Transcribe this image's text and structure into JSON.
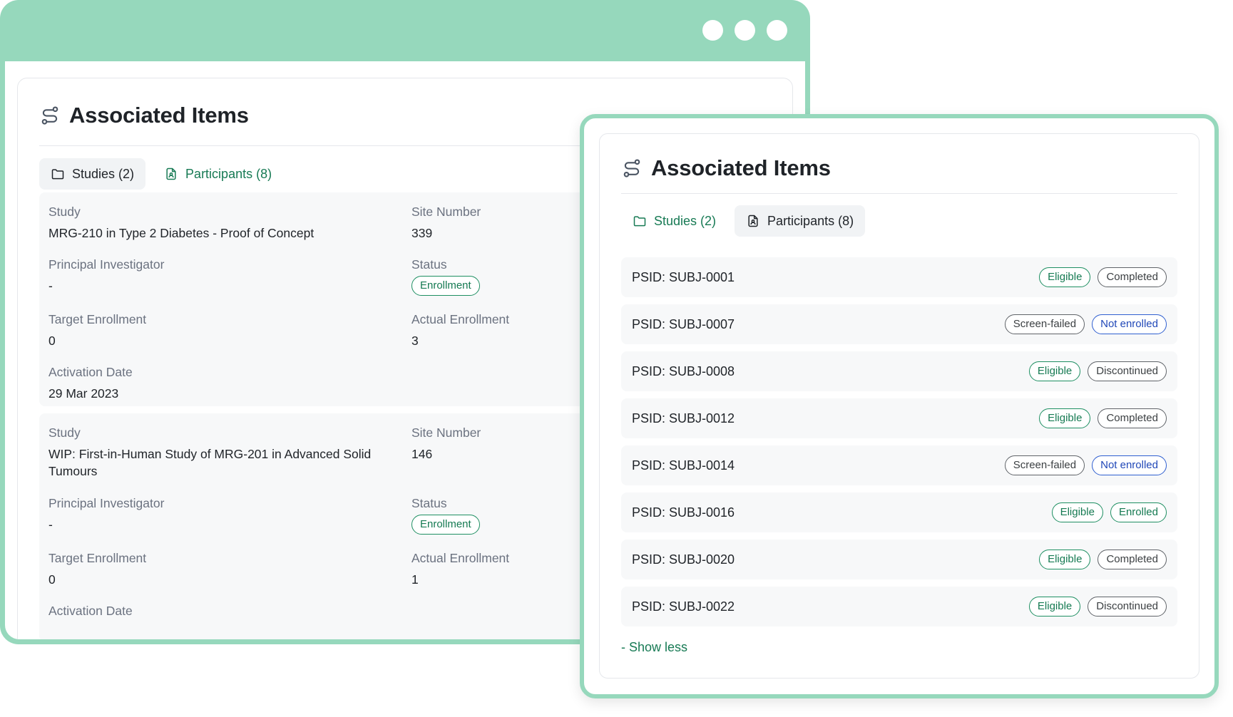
{
  "colors": {
    "frame": "#96d8bc",
    "accent": "#177a54",
    "badge_green": "#1e8f62",
    "badge_blue": "#2f5fd0",
    "badge_gray": "#5f6368"
  },
  "back_panel": {
    "title": "Associated Items",
    "header_icon": "route-icon",
    "tabs": [
      {
        "label": "Studies (2)",
        "icon": "folder-icon",
        "active": true
      },
      {
        "label": "Participants (8)",
        "icon": "file-user-icon",
        "active": false
      }
    ],
    "studies": [
      {
        "study_label": "Study",
        "study_value": "MRG-210 in Type 2 Diabetes - Proof of Concept",
        "site_label": "Site Number",
        "site_value": "339",
        "pi_label": "Principal Investigator",
        "pi_value": "-",
        "status_label": "Status",
        "status_value": "Enrollment",
        "target_label": "Target Enrollment",
        "target_value": "0",
        "actual_label": "Actual Enrollment",
        "actual_value": "3",
        "activation_label": "Activation Date",
        "activation_value": "29 Mar 2023"
      },
      {
        "study_label": "Study",
        "study_value": "WIP: First-in-Human Study of MRG-201 in Advanced Solid Tumours",
        "site_label": "Site Number",
        "site_value": "146",
        "pi_label": "Principal Investigator",
        "pi_value": "-",
        "status_label": "Status",
        "status_value": "Enrollment",
        "target_label": "Target Enrollment",
        "target_value": "0",
        "actual_label": "Actual Enrollment",
        "actual_value": "1",
        "activation_label": "Activation Date"
      }
    ]
  },
  "front_panel": {
    "title": "Associated Items",
    "header_icon": "route-icon",
    "tabs": [
      {
        "label": "Studies (2)",
        "icon": "folder-icon",
        "active": false
      },
      {
        "label": "Participants (8)",
        "icon": "file-user-icon",
        "active": true
      }
    ],
    "participants": [
      {
        "psid": "PSID: SUBJ-0001",
        "eligibility": "Eligible",
        "status": "Completed"
      },
      {
        "psid": "PSID: SUBJ-0007",
        "eligibility": "Screen-failed",
        "status": "Not enrolled"
      },
      {
        "psid": "PSID: SUBJ-0008",
        "eligibility": "Eligible",
        "status": "Discontinued"
      },
      {
        "psid": "PSID: SUBJ-0012",
        "eligibility": "Eligible",
        "status": "Completed"
      },
      {
        "psid": "PSID: SUBJ-0014",
        "eligibility": "Screen-failed",
        "status": "Not enrolled"
      },
      {
        "psid": "PSID: SUBJ-0016",
        "eligibility": "Eligible",
        "status": "Enrolled"
      },
      {
        "psid": "PSID: SUBJ-0020",
        "eligibility": "Eligible",
        "status": "Completed"
      },
      {
        "psid": "PSID: SUBJ-0022",
        "eligibility": "Eligible",
        "status": "Discontinued"
      }
    ],
    "show_less_label": "- Show less"
  }
}
